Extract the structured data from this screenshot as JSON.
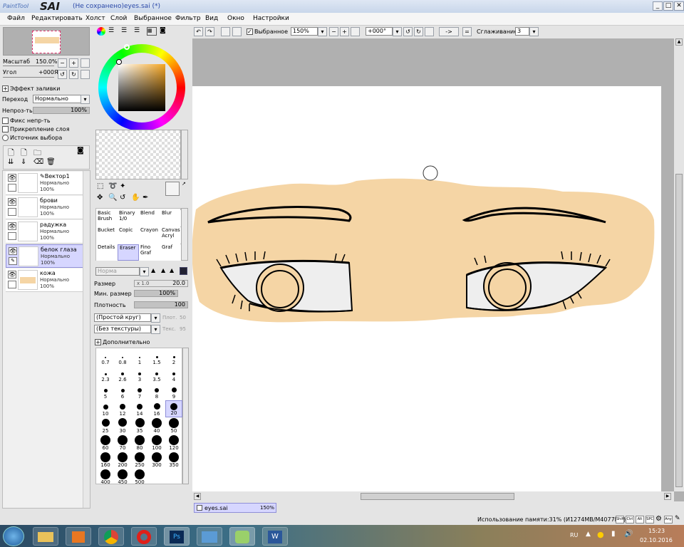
{
  "app": {
    "logo_small": "PaintTool",
    "logo_big": "SAI",
    "title": "(Не сохранено)eyes.sai (*)"
  },
  "window_buttons": [
    "_",
    "□",
    "✕"
  ],
  "menu": [
    "Файл",
    "Редактировать",
    "Холст",
    "Слой",
    "Выбранное",
    "Фильтр",
    "Вид",
    "Окно",
    "Настройки"
  ],
  "toolbar": {
    "selection_label": "Выбранное",
    "zoom": "150%",
    "angle": "+000°",
    "flip": "->",
    "smoothing_label": "Сглаживание",
    "smoothing": "3"
  },
  "navigator": {
    "zoom_label": "Масштаб",
    "zoom_value": "150.0%",
    "angle_label": "Угол",
    "angle_value": "+000Я"
  },
  "layer_props": {
    "fill_effect": "Эффект заливки",
    "blend_label": "Переход",
    "blend_value": "Нормально",
    "opacity_label": "Непроз-ть",
    "opacity_value": "100%",
    "opacity_fraction": 1.0,
    "fix_opacity": "Фикс непр-ть",
    "clip_layer": "Прикрепление слоя",
    "source": "Источник выбора"
  },
  "layers": [
    {
      "name": "Вектор1",
      "mode": "Нормально",
      "opacity": "100%",
      "selected": false
    },
    {
      "name": "брови",
      "mode": "Нормально",
      "opacity": "100%",
      "selected": false
    },
    {
      "name": "радужка",
      "mode": "Нормально",
      "opacity": "100%",
      "selected": false
    },
    {
      "name": "белок глаза",
      "mode": "Нормально",
      "opacity": "100%",
      "selected": true
    },
    {
      "name": "кожа",
      "mode": "Нормально",
      "opacity": "100%",
      "selected": false
    }
  ],
  "tools": [
    {
      "l1": "Basic",
      "l2": "Brush",
      "sel": false
    },
    {
      "l1": "Binary",
      "l2": "1/0",
      "sel": false
    },
    {
      "l1": "Blend",
      "l2": "",
      "sel": false
    },
    {
      "l1": "Blur",
      "l2": "",
      "sel": false
    },
    {
      "l1": "Bucket",
      "l2": "",
      "sel": false
    },
    {
      "l1": "Copic",
      "l2": "",
      "sel": false
    },
    {
      "l1": "Crayon",
      "l2": "",
      "sel": false
    },
    {
      "l1": "Canvas",
      "l2": "Acryl",
      "sel": false
    },
    {
      "l1": "Details",
      "l2": "",
      "sel": false
    },
    {
      "l1": "Eraser",
      "l2": "",
      "sel": true
    },
    {
      "l1": "Fino",
      "l2": "Graf",
      "sel": false
    },
    {
      "l1": "Graf",
      "l2": "",
      "sel": false
    }
  ],
  "brush": {
    "mode": "Норма",
    "size_label": "Размер",
    "size_mult": "x 1.0",
    "size_value": "20.0",
    "min_size_label": "Мин. размер",
    "min_size_value": "100%",
    "min_size_fraction": 1.0,
    "density_label": "Плотность",
    "density_value": "100",
    "density_fraction": 1.0,
    "shape": "(Простой круг)",
    "shape_val": "50",
    "texture": "(Без текстуры)",
    "texture_val": "95",
    "shape_tag": "Плот.",
    "texture_tag": "Текс.",
    "advanced": "Дополнительно"
  },
  "brush_sizes": [
    "0.7",
    "0.8",
    "1",
    "1.5",
    "2",
    "2.3",
    "2.6",
    "3",
    "3.5",
    "4",
    "5",
    "6",
    "7",
    "8",
    "9",
    "10",
    "12",
    "14",
    "16",
    "20",
    "25",
    "30",
    "35",
    "40",
    "50",
    "60",
    "70",
    "80",
    "100",
    "120",
    "160",
    "200",
    "250",
    "300",
    "350",
    "400",
    "450",
    "500"
  ],
  "selected_brush_size": "20",
  "document_tab": {
    "name": "eyes.sai",
    "zoom": "150%"
  },
  "status": {
    "memory": "Использование памяти:31% (И1274MB/M4077MB)",
    "keys": [
      "Shift",
      "Ctrl",
      "Alt",
      "SPC"
    ],
    "any": "Any"
  },
  "taskbar": {
    "lang": "RU",
    "time": "15:23",
    "date": "02.10.2016"
  },
  "colors": {
    "skin": "#f5d5a5",
    "sel_bg": "#d6d6ff",
    "canvas_bg": "#b0b0b0"
  }
}
